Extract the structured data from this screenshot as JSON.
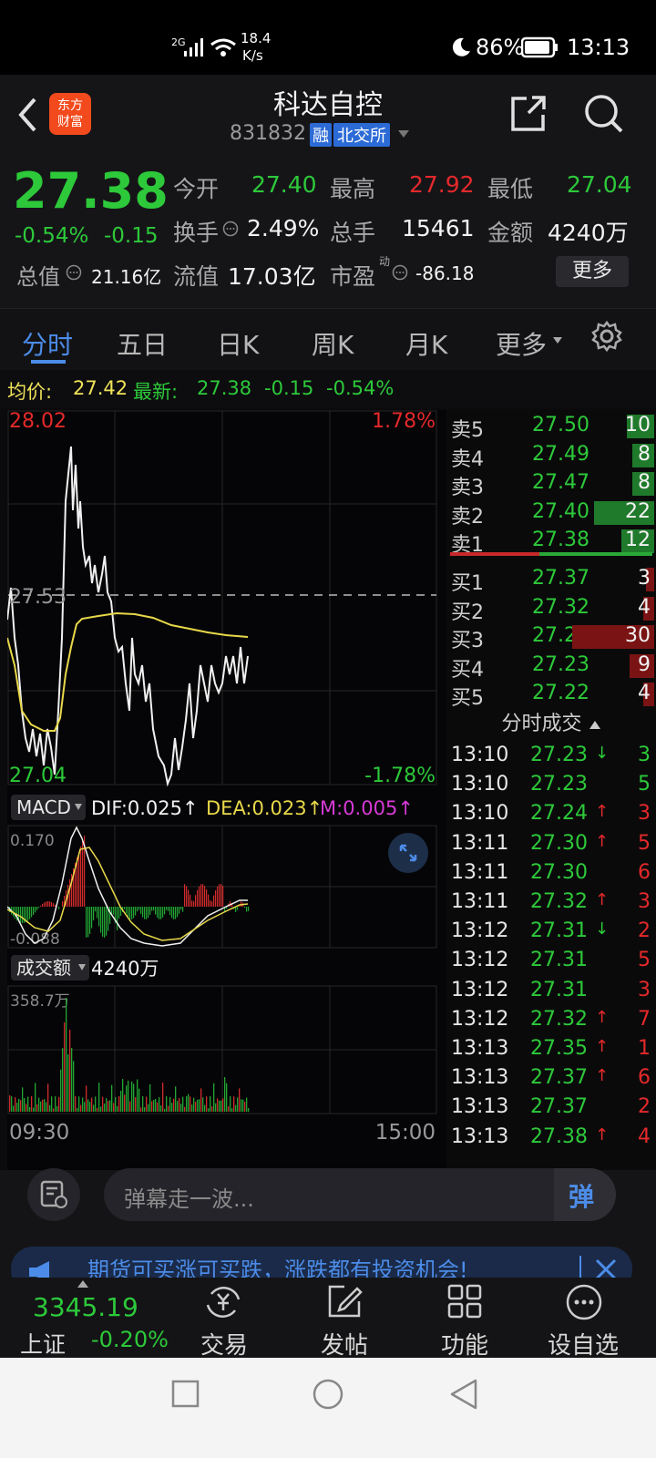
{
  "status": {
    "network": "2G",
    "speed_value": "18.4",
    "speed_unit": "K/s",
    "battery": "86%",
    "time": "13:13"
  },
  "header": {
    "title": "科达自控",
    "code": "831832",
    "badge_rong": "融",
    "badge_exchange": "北交所",
    "logo_line1": "东方",
    "logo_line2": "财富"
  },
  "quote": {
    "price": "27.38",
    "pct": "-0.54%",
    "chg": "-0.15",
    "open_label": "今开",
    "open": "27.40",
    "high_label": "最高",
    "high": "27.92",
    "low_label": "最低",
    "low": "27.04",
    "turnover_label": "换手",
    "turnover": "2.49%",
    "vol_label": "总手",
    "vol": "15461",
    "amount_label": "金额",
    "amount": "4240万",
    "mktcap_label": "总值",
    "mktcap": "21.16亿",
    "float_label": "流值",
    "float": "17.03亿",
    "pe_label": "市盈",
    "pe_sup": "动",
    "pe": "-86.18",
    "more": "更多"
  },
  "tabs": [
    "分时",
    "五日",
    "日K",
    "周K",
    "月K",
    "更多"
  ],
  "infobar": {
    "avg_label": "均价:",
    "avg": "27.42",
    "latest_label": "最新:",
    "latest": "27.38",
    "chg": "-0.15",
    "pct": "-0.54%"
  },
  "chart": {
    "ymax": "28.02",
    "ymax_pct": "1.78%",
    "mid": "27.53",
    "ymin": "27.04",
    "ymin_pct": "-1.78%",
    "macd_label": "MACD",
    "dif": "DIF:0.025↑",
    "dea": "DEA:0.023↑",
    "m": "M:0.005↑",
    "macd_top": "0.170",
    "macd_bottom": "-0.088",
    "vol_label": "成交额",
    "vol_total": "4240万",
    "vol_max": "358.7万",
    "t_start": "09:30",
    "t_end": "15:00"
  },
  "orderbook": {
    "asks": [
      {
        "label": "卖5",
        "price": "27.50",
        "vol": "10"
      },
      {
        "label": "卖4",
        "price": "27.49",
        "vol": "8"
      },
      {
        "label": "卖3",
        "price": "27.47",
        "vol": "8"
      },
      {
        "label": "卖2",
        "price": "27.40",
        "vol": "22"
      },
      {
        "label": "卖1",
        "price": "27.38",
        "vol": "12"
      }
    ],
    "bids": [
      {
        "label": "买1",
        "price": "27.37",
        "vol": "3"
      },
      {
        "label": "买2",
        "price": "27.32",
        "vol": "4"
      },
      {
        "label": "买3",
        "price": "27.24",
        "vol": "30"
      },
      {
        "label": "买4",
        "price": "27.23",
        "vol": "9"
      },
      {
        "label": "买5",
        "price": "27.22",
        "vol": "4"
      }
    ]
  },
  "ticks_title": "分时成交",
  "ticks": [
    {
      "t": "13:10",
      "p": "27.23",
      "dir": "down",
      "v": "3",
      "vc": "green"
    },
    {
      "t": "13:10",
      "p": "27.23",
      "dir": "",
      "v": "5",
      "vc": "green"
    },
    {
      "t": "13:10",
      "p": "27.24",
      "dir": "up",
      "v": "3",
      "vc": "red"
    },
    {
      "t": "13:11",
      "p": "27.30",
      "dir": "up",
      "v": "5",
      "vc": "red"
    },
    {
      "t": "13:11",
      "p": "27.30",
      "dir": "",
      "v": "6",
      "vc": "red"
    },
    {
      "t": "13:11",
      "p": "27.32",
      "dir": "up",
      "v": "3",
      "vc": "red"
    },
    {
      "t": "13:12",
      "p": "27.31",
      "dir": "down",
      "v": "2",
      "vc": "red"
    },
    {
      "t": "13:12",
      "p": "27.31",
      "dir": "",
      "v": "5",
      "vc": "red"
    },
    {
      "t": "13:12",
      "p": "27.31",
      "dir": "",
      "v": "3",
      "vc": "red"
    },
    {
      "t": "13:12",
      "p": "27.32",
      "dir": "up",
      "v": "7",
      "vc": "red"
    },
    {
      "t": "13:13",
      "p": "27.35",
      "dir": "up",
      "v": "1",
      "vc": "red"
    },
    {
      "t": "13:13",
      "p": "27.37",
      "dir": "up",
      "v": "6",
      "vc": "red"
    },
    {
      "t": "13:13",
      "p": "27.37",
      "dir": "",
      "v": "2",
      "vc": "red"
    },
    {
      "t": "13:13",
      "p": "27.38",
      "dir": "up",
      "v": "4",
      "vc": "red"
    }
  ],
  "danmu": {
    "placeholder": "弹幕走一波...",
    "button": "弹"
  },
  "banner": {
    "text": "期货可买涨可买跌，涨跌都有投资机会!"
  },
  "bottomnav": {
    "index_value": "3345.19",
    "index_name": "上证",
    "index_pct": "-0.20%",
    "trade": "交易",
    "post": "发帖",
    "func": "功能",
    "watch": "设自选"
  }
}
